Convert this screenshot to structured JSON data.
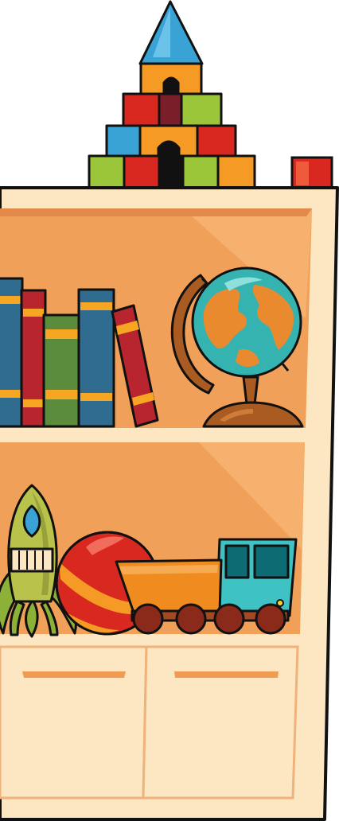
{
  "colors": {
    "outline": "#111111",
    "shelf_cream": "#fde7c3",
    "shelf_back": "#f0a058",
    "shelf_back_light": "#f6b16e",
    "shelf_side": "#e8934c",
    "block_blue": "#3aa3d6",
    "block_orange": "#f59a24",
    "block_red": "#d8281f",
    "block_green": "#9cc63a",
    "book_blue": "#2f6c8f",
    "book_red": "#b8252f",
    "book_green": "#5b8c3c",
    "book_band": "#f6a623",
    "globe_ocean": "#35b3b0",
    "globe_land": "#e98a2f",
    "globe_stand": "#a95b22",
    "rocket_body": "#b9c24a",
    "ball_red": "#d8281f",
    "ball_orange": "#f59a24",
    "truck_orange": "#f08b20",
    "truck_cab": "#3ec2c4",
    "wheel_dark": "#8a2a1a",
    "drawer_handle": "#f29a52"
  },
  "objects": {
    "block_tower": "toy-block-tower",
    "loose_block": "red-toy-block",
    "books": [
      "blue-book",
      "red-book",
      "green-book",
      "blue-book",
      "leaning-red-book"
    ],
    "globe": "desk-globe",
    "rocket": "toy-rocket",
    "ball": "striped-ball",
    "truck": "toy-dump-truck",
    "drawers": [
      "left-drawer",
      "right-drawer"
    ]
  }
}
